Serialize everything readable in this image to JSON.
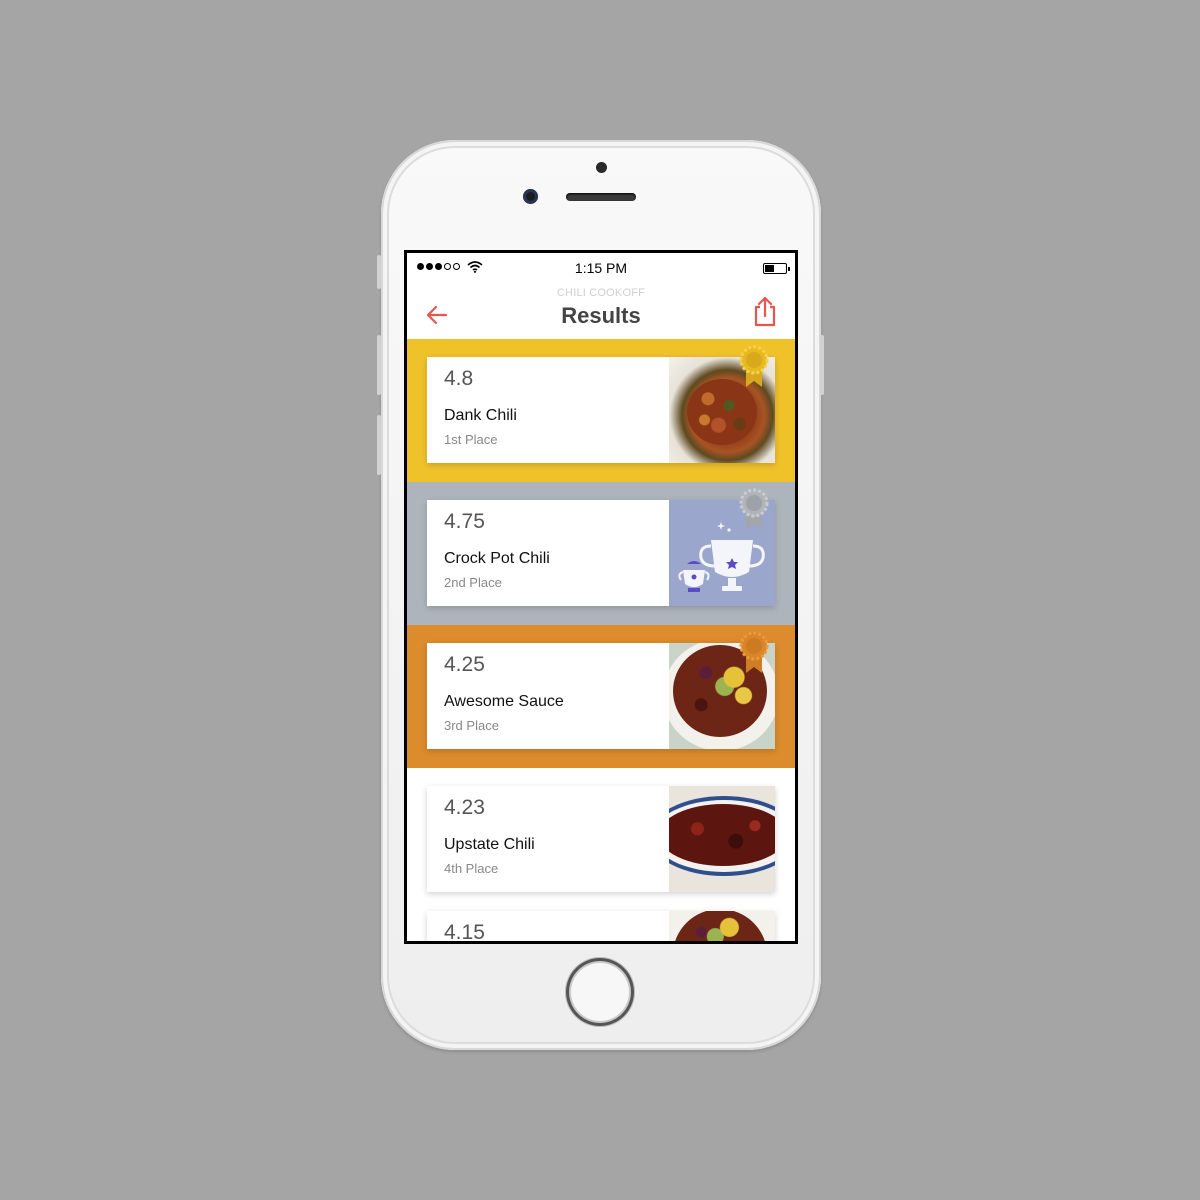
{
  "status_bar": {
    "time": "1:15 PM"
  },
  "nav": {
    "subtitle": "CHILI COOKOFF",
    "title": "Results"
  },
  "colors": {
    "first_bg": "#f0c22a",
    "second_bg": "#aeb4bb",
    "third_bg": "#dc8c2c",
    "accent_red": "#e8554f"
  },
  "results": [
    {
      "score": "4.8",
      "name": "Dank Chili",
      "place": "1st Place",
      "image": "chili-bowl-photo",
      "medal": "gold-medal-icon"
    },
    {
      "score": "4.75",
      "name": "Crock Pot Chili",
      "place": "2nd Place",
      "image": "trophy-illustration",
      "medal": "silver-medal-icon"
    },
    {
      "score": "4.25",
      "name": "Awesome Sauce",
      "place": "3rd Place",
      "image": "chili-with-toppings-photo",
      "medal": "bronze-medal-icon"
    },
    {
      "score": "4.23",
      "name": "Upstate Chili",
      "place": "4th Place",
      "image": "chili-pot-photo"
    },
    {
      "score": "4.15",
      "image": "chili-with-toppings-photo"
    }
  ]
}
